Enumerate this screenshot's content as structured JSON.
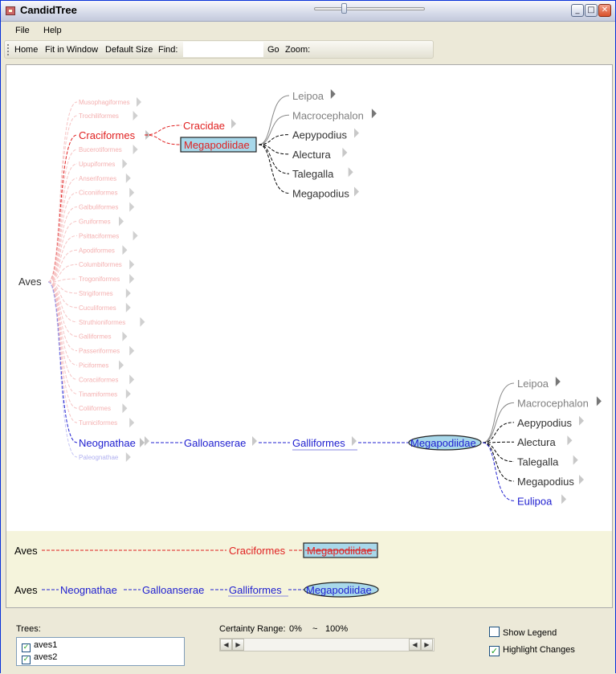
{
  "window": {
    "title": "CandidTree"
  },
  "menu": [
    "File",
    "Help"
  ],
  "toolbar": {
    "home": "Home",
    "fit": "Fit in Window",
    "default_size": "Default Size",
    "find_label": "Find:",
    "find_value": "",
    "go": "Go",
    "zoom_label": "Zoom:",
    "zoom_level": 0.25
  },
  "colors": {
    "tree1": "#e02020",
    "tree2": "#2020d0",
    "faded1": "#f4b0b0",
    "faded2": "#b0b0f0",
    "highlight_fill": "#a8d8ea",
    "grey": "#808080",
    "path_panel_bg": "#f5f4dc"
  },
  "tree": {
    "root": "Aves",
    "top_orders": [
      "Musophagiformes",
      "Trochiliformes"
    ],
    "craciformes": "Craciformes",
    "craciformes_children": [
      "Cracidae",
      "Megapodiidae"
    ],
    "other_orders": [
      "Bucerotiformes",
      "Upupiformes",
      "Anseriformes",
      "Ciconiiformes",
      "Galbuliformes",
      "Gruiformes",
      "Psittaciformes",
      "Apodiformes",
      "Columbiformes",
      "Trogoniformes",
      "Strigiformes",
      "Cuculiformes",
      "Struthioniformes",
      "Galliformes",
      "Passeriformes",
      "Piciformes",
      "Coraciiformes",
      "Tinamiformes",
      "Coliiformes",
      "Turniciformes"
    ],
    "neognathae": "Neognathae",
    "paleognathae": "Paleognathae",
    "galloanserae": "Galloanserae",
    "galliformes": "Galliformes",
    "megapodiidae": "Megapodiidae",
    "genera1": [
      "Leipoa",
      "Macrocephalon",
      "Aepypodius",
      "Alectura",
      "Talegalla",
      "Megapodius"
    ],
    "genera2": [
      "Leipoa",
      "Macrocephalon",
      "Aepypodius",
      "Alectura",
      "Talegalla",
      "Megapodius",
      "Eulipoa"
    ]
  },
  "paths": {
    "path1": [
      "Aves",
      "Craciformes",
      "Megapodiidae"
    ],
    "path2": [
      "Aves",
      "Neognathae",
      "Galloanserae",
      "Galliformes",
      "Megapodiidae"
    ]
  },
  "bottom": {
    "trees_label": "Trees:",
    "trees": [
      {
        "name": "aves1",
        "checked": true
      },
      {
        "name": "aves2",
        "checked": true
      }
    ],
    "certainty_label": "Certainty Range:",
    "certainty_min": "0%",
    "certainty_sep": "~",
    "certainty_max": "100%",
    "show_legend": "Show Legend",
    "show_legend_checked": false,
    "highlight_changes": "Highlight Changes",
    "highlight_changes_checked": true
  }
}
